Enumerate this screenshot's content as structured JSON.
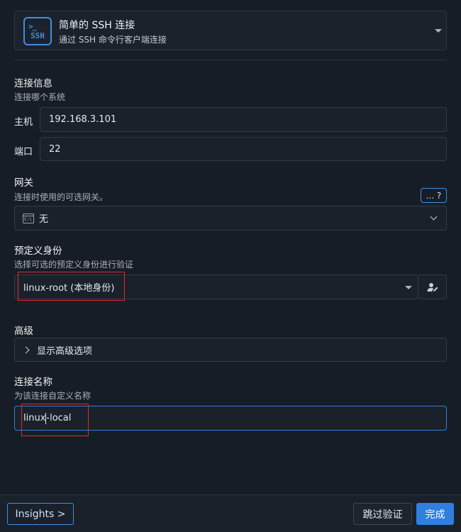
{
  "connection_type": {
    "icon": "ssh-terminal-icon",
    "icon_prompt": ">_",
    "icon_text": "SSH",
    "title": "简单的 SSH 连接",
    "description": "通过 SSH 命令行客户端连接"
  },
  "connection_info": {
    "title": "连接信息",
    "subtitle": "连接哪个系统",
    "host_label": "主机",
    "host_value": "192.168.3.101",
    "port_label": "端口",
    "port_value": "22"
  },
  "gateway": {
    "title": "网关",
    "subtitle": "连接时使用的可选网关。",
    "help_label": "... ?",
    "selected_icon": "terminal-icon",
    "selected": "无"
  },
  "identity": {
    "title": "预定义身份",
    "subtitle": "选择可选的预定义身份进行验证",
    "selected": "linux-root (本地身份)",
    "edit_icon": "user-edit-icon"
  },
  "advanced": {
    "title": "高级",
    "toggle_label": "显示高级选项"
  },
  "connection_name": {
    "title": "连接名称",
    "subtitle": "为该连接自定义名称",
    "value_before_cursor": "linux",
    "value_after_cursor": "-local"
  },
  "footer": {
    "insights_label": "Insights >",
    "skip_label": "跳过验证",
    "done_label": "完成"
  },
  "colors": {
    "accent": "#2f7fe0",
    "highlight_box": "#e02a2a",
    "background": "#171d26"
  }
}
